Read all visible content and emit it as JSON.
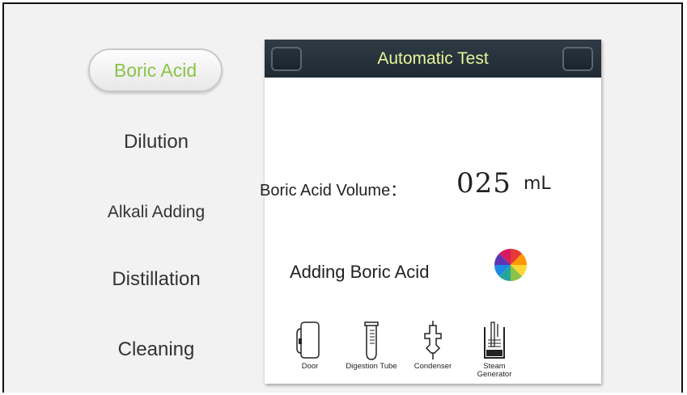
{
  "steps": {
    "active": "Boric Acid",
    "items": [
      "Dilution",
      "Alkali Adding",
      "Distillation",
      "Cleaning"
    ]
  },
  "panel": {
    "title": "Automatic Test",
    "volume_label": "Boric Acid Volume：",
    "volume_value": "025",
    "volume_unit": "mL",
    "status": "Adding Boric Acid",
    "devices": [
      {
        "label": "Door",
        "icon": "door-icon"
      },
      {
        "label": "Digestion Tube",
        "icon": "digestion-tube-icon"
      },
      {
        "label": "Condenser",
        "icon": "condenser-icon"
      },
      {
        "label": "Steam Generator",
        "icon": "steam-generator-icon"
      }
    ]
  },
  "colors": {
    "active_step": "#8bc34a",
    "header_bg": "#27333c",
    "header_title": "#e6f59a"
  }
}
